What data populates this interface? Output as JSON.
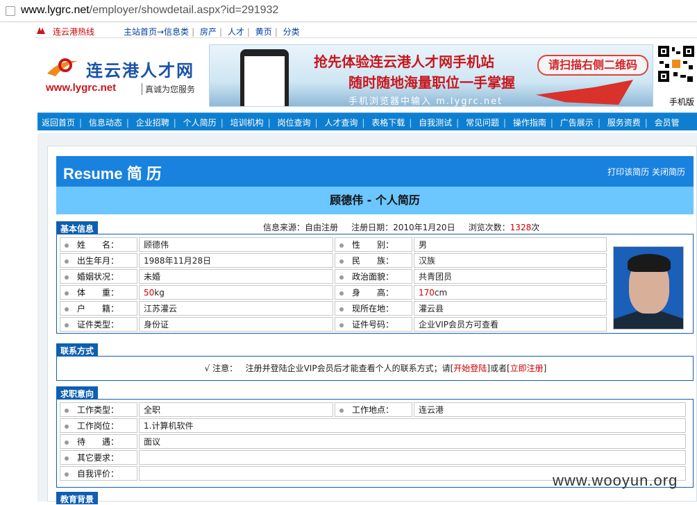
{
  "browser": {
    "url_domain": "www.lygrc.net",
    "url_path": "/employer/showdetail.aspx?id=291932"
  },
  "topnav": {
    "hotline": "连云港热线",
    "links": [
      "主站首页→信息类",
      "房产",
      "人才",
      "黄页",
      "分类"
    ]
  },
  "header": {
    "logo_cn": "连云港人才网",
    "logo_url": "www.lygrc.net",
    "slogan": "真诚为您服务",
    "banner_line1": "抢先体验连云港人才网手机站",
    "banner_line2": "随时随地海量职位一手掌握",
    "banner_line3": "手机浏览器中输入 m.lygrc.net",
    "banner_tip": "请扫描右侧二维码",
    "qr_label": "手机版"
  },
  "menu": [
    "返回首页",
    "信息动态",
    "企业招聘",
    "个人简历",
    "培训机构",
    "岗位查询",
    "人才查询",
    "表格下载",
    "自我测试",
    "常见问题",
    "操作指南",
    "广告展示",
    "服务资费",
    "会员管"
  ],
  "resume": {
    "title": "Resume 简 历",
    "print": "打印该简历",
    "close": "关闭简历",
    "name_title": "顾德伟 - 个人简历"
  },
  "basic": {
    "tab": "基本信息",
    "source_label": "信息来源：",
    "source": "自由注册",
    "reg_label": "注册日期：",
    "reg_date": "2010年1月20日",
    "views_label": "浏览次数：",
    "views": "1328",
    "views_unit": "次",
    "rows": [
      {
        "k1": "姓　　名：",
        "v1": "顾德伟",
        "k2": "性　　别：",
        "v2": "男"
      },
      {
        "k1": "出生年月：",
        "v1": "1988年11月28日",
        "k2": "民　　族：",
        "v2": "汉族"
      },
      {
        "k1": "婚姻状况：",
        "v1": "未婚",
        "k2": "政治面貌：",
        "v2": "共青团员"
      },
      {
        "k1": "体　　重：",
        "v1": "50",
        "v1u": "kg",
        "k2": "身　　高：",
        "v2": "170",
        "v2u": "cm"
      },
      {
        "k1": "户　　籍：",
        "v1": "江苏灌云",
        "k2": "现所在地：",
        "v2": "灌云县"
      },
      {
        "k1": "证件类型：",
        "v1": "身份证",
        "k2": "证件号码：",
        "v2": "企业VIP会员方可查看"
      }
    ]
  },
  "contact": {
    "tab": "联系方式",
    "check": "√",
    "note_label": "注意：",
    "note_text": "注册并登陆企业VIP会员后才能查看个人的联系方式；请[",
    "login": "开始登陆",
    "or": "]或者[",
    "register": "立即注册",
    "end": "]"
  },
  "intent": {
    "tab": "求职意向",
    "type_label": "工作类型：",
    "type": "全职",
    "place_label": "工作地点：",
    "place": "连云港",
    "post_label": "工作岗位：",
    "post": "1.计算机软件",
    "pay_label": "待　　遇：",
    "pay": "面议",
    "other_label": "其它要求：",
    "other": "",
    "self_label": "自我评价：",
    "self": ""
  },
  "edu": {
    "tab": "教育背景"
  },
  "watermark": "www.wooyun.org"
}
